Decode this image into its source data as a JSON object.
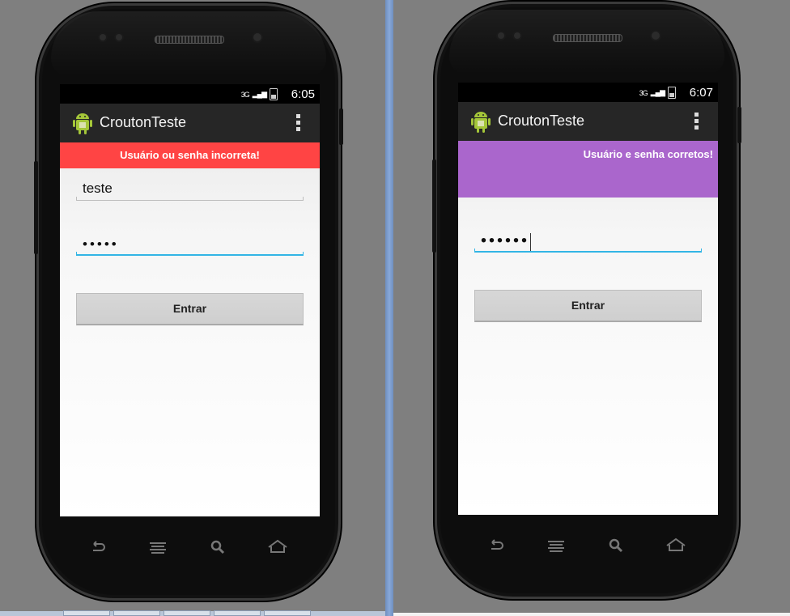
{
  "left_screen": {
    "status_bar": {
      "network": "3G",
      "time": "6:05"
    },
    "action_bar": {
      "title": "CroutonTeste",
      "icon": "android-icon",
      "menu_icon": "overflow-menu-icon"
    },
    "crouton": {
      "text": "Usuário ou senha incorreta!",
      "color": "#ff4444"
    },
    "username_field": {
      "value": "teste"
    },
    "password_field": {
      "value": "•••••"
    },
    "login_button": {
      "label": "Entrar"
    },
    "nav_buttons": [
      "back-icon",
      "recent-apps-icon",
      "search-icon",
      "home-icon"
    ]
  },
  "right_screen": {
    "status_bar": {
      "network": "3G",
      "time": "6:07"
    },
    "action_bar": {
      "title": "CroutonTeste",
      "icon": "android-icon",
      "menu_icon": "overflow-menu-icon"
    },
    "crouton": {
      "text": "Usuário e senha corretos!",
      "color": "#aa66cc"
    },
    "password_field": {
      "value": "••••••"
    },
    "login_button": {
      "label": "Entrar"
    },
    "nav_buttons": [
      "back-icon",
      "recent-apps-icon",
      "search-icon",
      "home-icon"
    ]
  },
  "colors": {
    "background": "#7f7f7f",
    "action_bar": "#262626",
    "focus_underline": "#33b5e5"
  }
}
